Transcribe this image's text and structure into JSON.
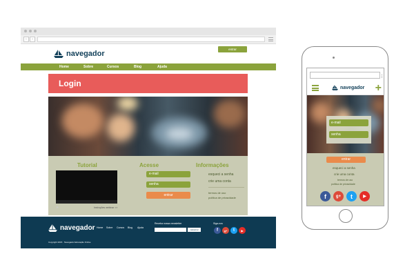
{
  "desktop": {
    "brand": "navegador",
    "header_button": "entrar",
    "nav": [
      "Home",
      "Sobre",
      "Cursos",
      "Blog",
      "Ajuda"
    ],
    "page_title": "Login",
    "tutorial": {
      "title": "Tutorial",
      "video_caption": "Instruções webinar >>"
    },
    "acesse": {
      "title": "Acesse",
      "email_placeholder": "e-mail",
      "password_placeholder": "senha",
      "submit": "entrar"
    },
    "info": {
      "title": "Informações",
      "forgot": "esqueci a senha",
      "create": "crie uma conta",
      "terms": "termos de uso",
      "privacy": "política de privacidade"
    },
    "footer": {
      "brand": "navegador",
      "nav": [
        "Home",
        "Sobre",
        "Cursos",
        "Blog",
        "Ajuda"
      ],
      "newsletter_label": "Receba nossa newsletter",
      "newsletter_button": "cadastrar",
      "follow_label": "Siga-nos",
      "copyright": "Copyright 2015 · Navegador Educação Online",
      "social": [
        "f",
        "g+",
        "t",
        "▶"
      ]
    }
  },
  "mobile": {
    "brand": "navegador",
    "email_placeholder": "e-mail",
    "password_placeholder": "senha",
    "submit": "entrar",
    "forgot": "esqueci a senha",
    "create": "crie uma conta",
    "terms": "termos de uso",
    "privacy": "política de privacidade",
    "social": [
      "f",
      "g+",
      "t",
      "▶"
    ]
  },
  "colors": {
    "green": "#8ba33c",
    "red": "#e85c5a",
    "orange": "#ea8b4b",
    "navy": "#0e3a52",
    "panel": "#c9cbb3",
    "facebook": "#3b5998",
    "googleplus": "#dd4b39",
    "twitter": "#1da1f2",
    "youtube": "#e52d27"
  }
}
